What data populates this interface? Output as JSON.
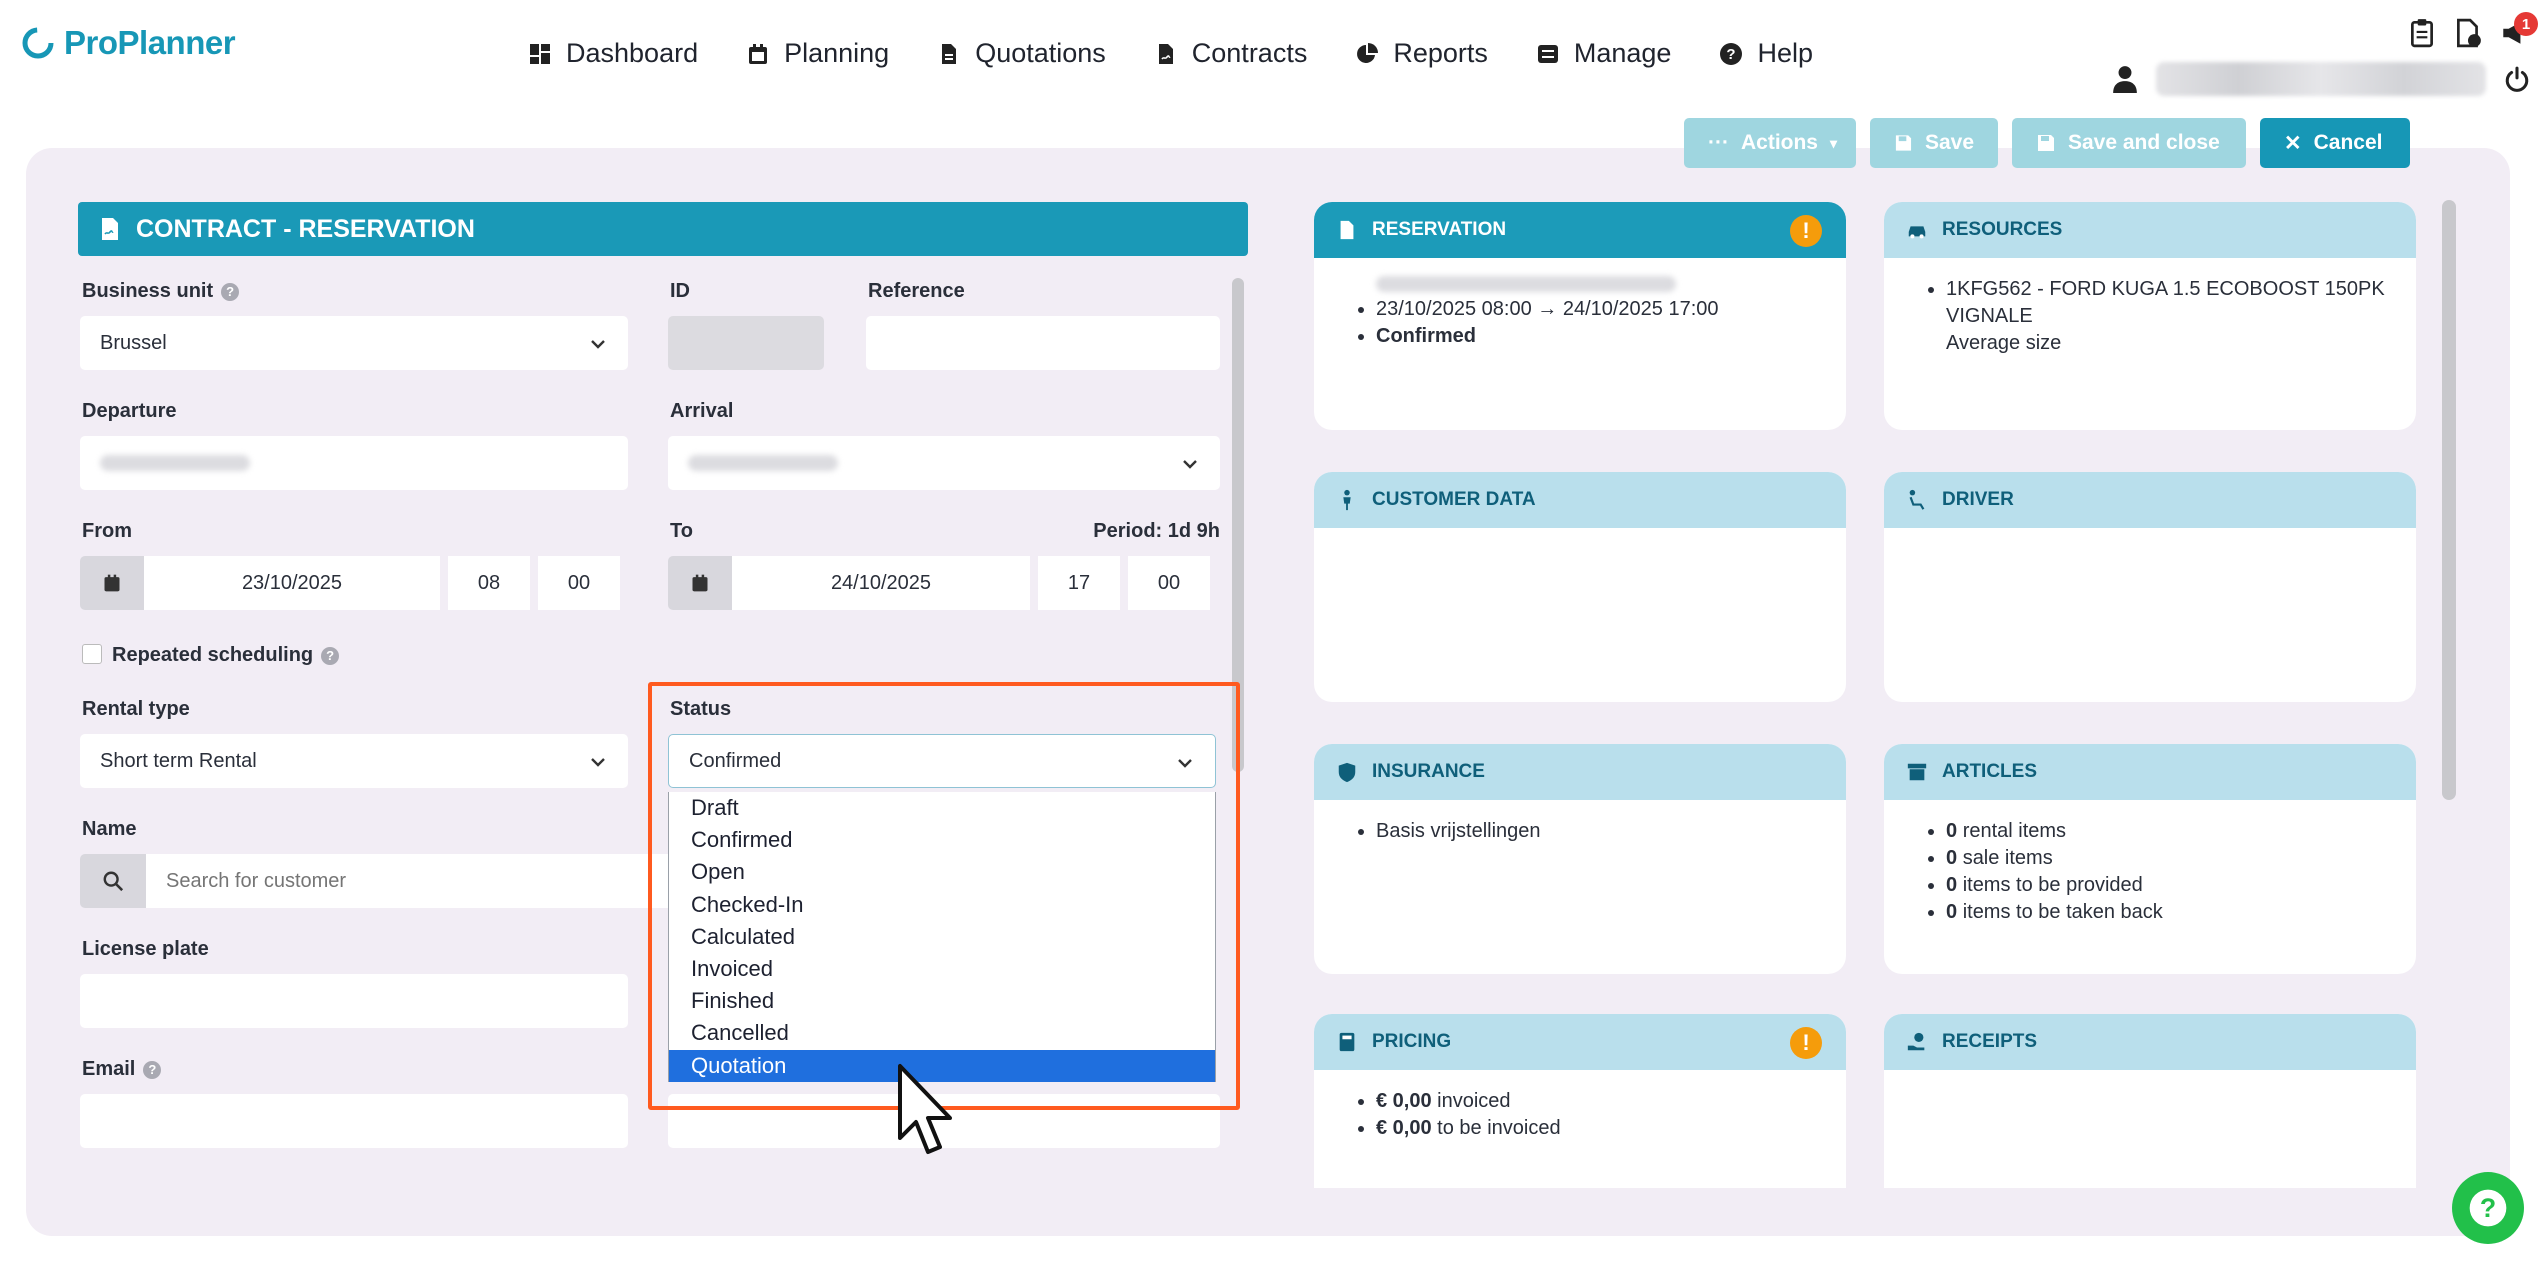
{
  "brand": {
    "name": "ProPlanner",
    "color": "#1797b6"
  },
  "nav": [
    {
      "icon": "dashboard-icon",
      "label": "Dashboard"
    },
    {
      "icon": "calendar-icon",
      "label": "Planning"
    },
    {
      "icon": "document-icon",
      "label": "Quotations"
    },
    {
      "icon": "contract-icon",
      "label": "Contracts"
    },
    {
      "icon": "pie-chart-icon",
      "label": "Reports"
    },
    {
      "icon": "manage-icon",
      "label": "Manage"
    },
    {
      "icon": "question-icon",
      "label": "Help"
    }
  ],
  "notifications": {
    "count": "1"
  },
  "toolbar": {
    "actions": "Actions",
    "save": "Save",
    "save_close": "Save and close",
    "cancel": "Cancel"
  },
  "form": {
    "title": "CONTRACT - RESERVATION",
    "business_unit_label": "Business unit",
    "business_unit_value": "Brussel",
    "id_label": "ID",
    "reference_label": "Reference",
    "departure_label": "Departure",
    "arrival_label": "Arrival",
    "from_label": "From",
    "from_date": "23/10/2025",
    "from_hour": "08",
    "from_min": "00",
    "to_label": "To",
    "period": "Period: 1d 9h",
    "to_date": "24/10/2025",
    "to_hour": "17",
    "to_min": "00",
    "repeated_label": "Repeated scheduling",
    "rental_type_label": "Rental type",
    "rental_type_value": "Short term Rental",
    "status_label": "Status",
    "status_value": "Confirmed",
    "name_label": "Name",
    "name_placeholder": "Search for customer",
    "license_label": "License plate",
    "email_label": "Email"
  },
  "status_options": [
    "Draft",
    "Confirmed",
    "Open",
    "Checked-In",
    "Calculated",
    "Invoiced",
    "Finished",
    "Cancelled",
    "Quotation"
  ],
  "highlight_color": "#ff5a1f",
  "cards": {
    "reservation": {
      "title": "RESERVATION",
      "period": "23/10/2025 08:00 → 24/10/2025 17:00",
      "status": "Confirmed"
    },
    "resources": {
      "title": "RESOURCES",
      "line1": "1KFG562 - FORD KUGA 1.5 ECOBOOST 150PK",
      "line2": "VIGNALE",
      "line3": "Average size"
    },
    "customer": {
      "title": "CUSTOMER DATA"
    },
    "driver": {
      "title": "DRIVER"
    },
    "insurance": {
      "title": "INSURANCE",
      "item": "Basis vrijstellingen"
    },
    "articles": {
      "title": "ARTICLES",
      "items": [
        {
          "n": "0",
          "t": "rental items"
        },
        {
          "n": "0",
          "t": "sale items"
        },
        {
          "n": "0",
          "t": "items to be provided"
        },
        {
          "n": "0",
          "t": "items to be taken back"
        }
      ]
    },
    "pricing": {
      "title": "PRICING",
      "items": [
        {
          "n": "€ 0,00",
          "t": "invoiced"
        },
        {
          "n": "€ 0,00",
          "t": "to be invoiced"
        }
      ]
    },
    "receipts": {
      "title": "RECEIPTS"
    }
  }
}
